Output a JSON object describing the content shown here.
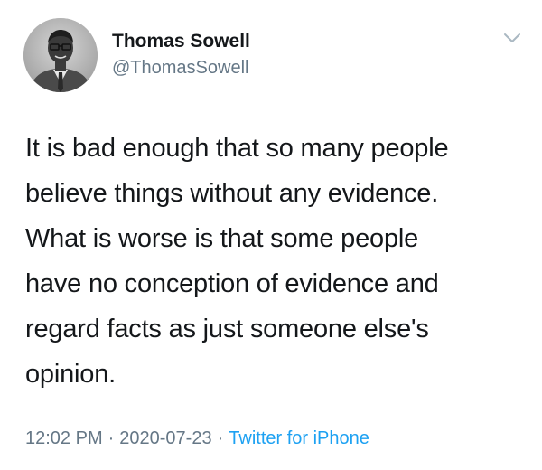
{
  "author": {
    "name": "Thomas Sowell",
    "handle": "@ThomasSowell"
  },
  "tweet": {
    "lines": [
      "It is bad enough that so many people",
      "believe things without any evidence.",
      "What is worse is that some people",
      "have no conception of evidence and",
      "regard facts as just someone else's",
      "opinion."
    ],
    "time": "12:02 PM",
    "date": "2020-07-23",
    "separator": "·",
    "source": "Twitter for iPhone"
  },
  "icons": {
    "menu": "chevron-down-icon",
    "avatar": "profile-photo"
  },
  "colors": {
    "text": "#14171a",
    "secondary": "#657786",
    "link": "#1da1f2"
  }
}
